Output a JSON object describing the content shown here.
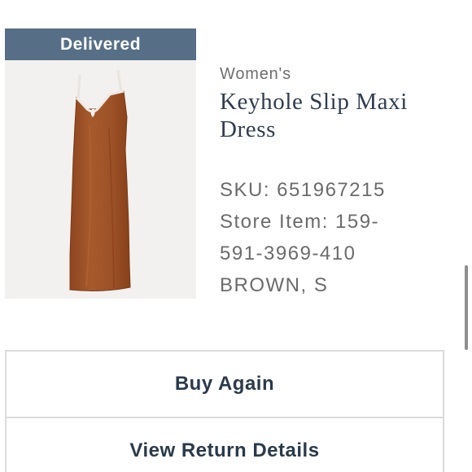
{
  "order_item": {
    "status": "Delivered",
    "category": "Women's",
    "product_name": "Keyhole Slip Maxi Dress",
    "sku": "SKU: 651967215",
    "store_item": "Store Item: 159-591-3969-410",
    "variant": "BROWN, S",
    "image_icon": "brown-slip-dress-photo"
  },
  "actions": {
    "buy_again": "Buy Again",
    "view_return_details": "View Return Details"
  },
  "colors": {
    "status_bar": "#566f87",
    "product_color": "#9c4f25",
    "title_text": "#2f3d4e"
  }
}
